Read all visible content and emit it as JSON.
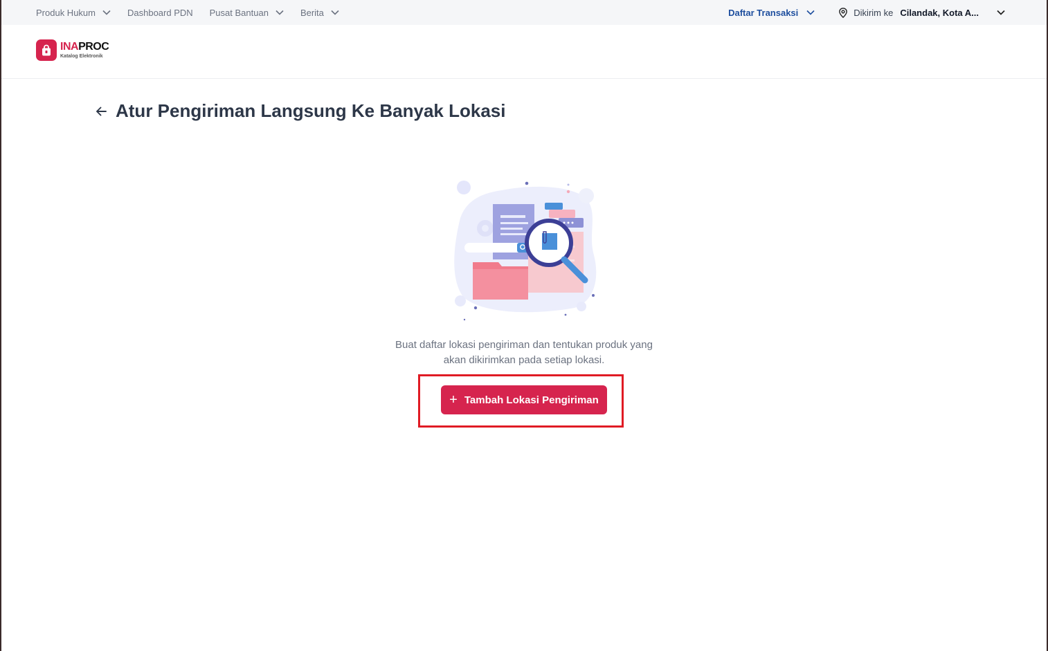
{
  "topbar": {
    "nav": [
      {
        "label": "Produk Hukum",
        "has_dropdown": true
      },
      {
        "label": "Dashboard PDN",
        "has_dropdown": false
      },
      {
        "label": "Pusat Bantuan",
        "has_dropdown": true
      },
      {
        "label": "Berita",
        "has_dropdown": true
      }
    ],
    "transactions_label": "Daftar Transaksi",
    "ship_prefix": "Dikirim ke",
    "ship_location": "Cilandak, Kota A..."
  },
  "logo": {
    "name_part1": "INA",
    "name_part2": "PROC",
    "subtitle": "Katalog Elektronik"
  },
  "page": {
    "title": "Atur Pengiriman Langsung Ke Banyak Lokasi",
    "description_line1": "Buat daftar lokasi pengiriman dan tentukan produk yang",
    "description_line2": "akan dikirimkan pada setiap lokasi.",
    "cta_icon": "+",
    "cta_label": "Tambah Lokasi Pengiriman"
  },
  "colors": {
    "brand": "#d6244e",
    "link": "#1d4e9e",
    "highlight_border": "#e01b24"
  },
  "icons": [
    "chevron-down-icon",
    "location-pin-icon",
    "arrow-left-icon",
    "shopping-bag-icon",
    "plus-icon"
  ]
}
